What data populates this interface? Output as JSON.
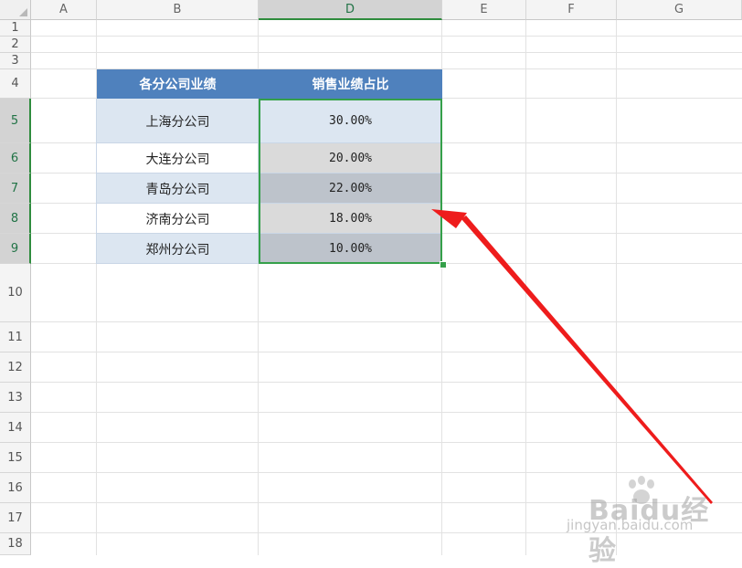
{
  "columns": [
    {
      "label": "A"
    },
    {
      "label": "B"
    },
    {
      "label": "D"
    },
    {
      "label": "E"
    },
    {
      "label": "F"
    },
    {
      "label": "G"
    }
  ],
  "rows": [
    "1",
    "2",
    "3",
    "4",
    "5",
    "6",
    "7",
    "8",
    "9",
    "10",
    "11",
    "12",
    "13",
    "14",
    "15",
    "16",
    "17",
    "18"
  ],
  "table": {
    "header": {
      "company": "各分公司业绩",
      "ratio": "销售业绩占比"
    },
    "records": [
      {
        "company": "上海分公司",
        "ratio": "30.00%"
      },
      {
        "company": "大连分公司",
        "ratio": "20.00%"
      },
      {
        "company": "青岛分公司",
        "ratio": "22.00%"
      },
      {
        "company": "济南分公司",
        "ratio": "18.00%"
      },
      {
        "company": "郑州分公司",
        "ratio": "10.00%"
      }
    ]
  },
  "selection": {
    "range": "D5:D9",
    "color": "#35a04a"
  },
  "annotation": {
    "arrow_color": "#ee1c1c"
  },
  "watermark": {
    "logo": "Baidu经验",
    "url": "jingyan.baidu.com"
  },
  "colors": {
    "header_fill": "#4f81bd",
    "band_fill": "#dce6f1",
    "gray_a": "#dadada",
    "gray_b": "#bdc3cb"
  }
}
